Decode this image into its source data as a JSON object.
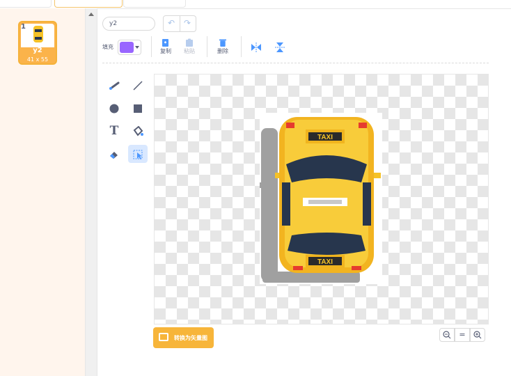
{
  "costume": {
    "number": "1",
    "name": "y2",
    "size": "41 x 55"
  },
  "toolbar": {
    "name_value": "y2",
    "fill_label": "填充",
    "fill_color": "#9966ff",
    "copy_label": "复制",
    "paste_label": "粘贴",
    "delete_label": "删除"
  },
  "tools": [
    "brush-icon",
    "line-icon",
    "circle-icon",
    "rectangle-icon",
    "text-icon",
    "fill-icon",
    "eraser-icon",
    "select-icon"
  ],
  "taxi_sign": "TAXI",
  "convert_label": "转换为矢量图",
  "zoom": {
    "out": "−",
    "reset": "=",
    "in": "+"
  }
}
